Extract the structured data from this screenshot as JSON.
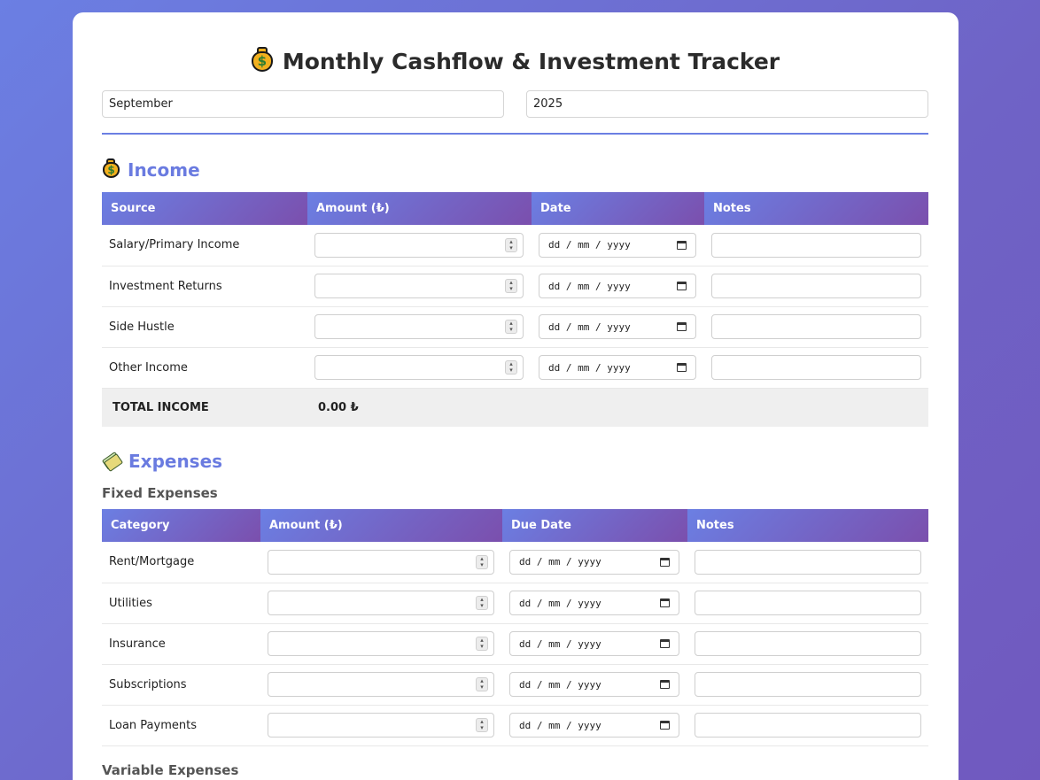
{
  "header": {
    "title": "Monthly Cashflow & Investment Tracker",
    "icon": "money-bag-icon"
  },
  "period": {
    "month": "September",
    "year": "2025"
  },
  "income": {
    "title": "Income",
    "columns": [
      "Source",
      "Amount (₺)",
      "Date",
      "Notes"
    ],
    "rows": [
      {
        "source": "Salary/Primary Income",
        "date_placeholder": "dd / mm / yyyy"
      },
      {
        "source": "Investment Returns",
        "date_placeholder": "dd / mm / yyyy"
      },
      {
        "source": "Side Hustle",
        "date_placeholder": "dd / mm / yyyy"
      },
      {
        "source": "Other Income",
        "date_placeholder": "dd / mm / yyyy"
      }
    ],
    "total_label": "TOTAL INCOME",
    "total_value": "0.00 ₺"
  },
  "expenses": {
    "title": "Expenses",
    "fixed_title": "Fixed Expenses",
    "columns": [
      "Category",
      "Amount (₺)",
      "Due Date",
      "Notes"
    ],
    "rows": [
      {
        "category": "Rent/Mortgage",
        "date_placeholder": "dd / mm / yyyy"
      },
      {
        "category": "Utilities",
        "date_placeholder": "dd / mm / yyyy"
      },
      {
        "category": "Insurance",
        "date_placeholder": "dd / mm / yyyy"
      },
      {
        "category": "Subscriptions",
        "date_placeholder": "dd / mm / yyyy"
      },
      {
        "category": "Loan Payments",
        "date_placeholder": "dd / mm / yyyy"
      }
    ],
    "variable_title": "Variable Expenses"
  },
  "colors": {
    "accent": "#6a7be0",
    "gradient_end": "#7b4fad"
  }
}
